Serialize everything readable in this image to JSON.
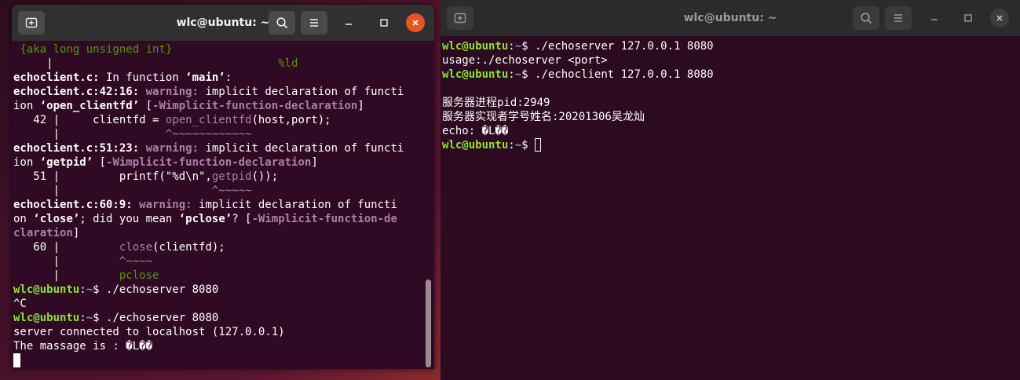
{
  "left_window": {
    "title": "wlc@ubuntu: ~",
    "lines": [
      [
        {
          "t": " {aka long unsigned int}",
          "c": "grn"
        }
      ],
      [
        {
          "t": "     |                                  "
        },
        {
          "t": "%ld",
          "c": "grn"
        }
      ],
      [
        {
          "t": "echoclient.c:",
          "c": "b"
        },
        {
          "t": " In function "
        },
        {
          "t": "‘main’",
          "c": "b"
        },
        {
          "t": ":"
        }
      ],
      [
        {
          "t": "echoclient.c:42:16:",
          "c": "b"
        },
        {
          "t": " "
        },
        {
          "t": "warning:",
          "c": "mb"
        },
        {
          "t": " implicit declaration of functi"
        }
      ],
      [
        {
          "t": "ion "
        },
        {
          "t": "‘open_clientfd’",
          "c": "b"
        },
        {
          "t": " ["
        },
        {
          "t": "-Wimplicit-function-declaration",
          "c": "mb"
        },
        {
          "t": "]"
        }
      ],
      [
        {
          "t": "   42 |     clientfd = "
        },
        {
          "t": "open_clientfd",
          "c": "m"
        },
        {
          "t": "(host,port);"
        }
      ],
      [
        {
          "t": "      |                "
        },
        {
          "t": "^~~~~~~~~~~~~",
          "c": "m"
        }
      ],
      [
        {
          "t": "echoclient.c:51:23:",
          "c": "b"
        },
        {
          "t": " "
        },
        {
          "t": "warning:",
          "c": "mb"
        },
        {
          "t": " implicit declaration of functi"
        }
      ],
      [
        {
          "t": "ion "
        },
        {
          "t": "‘getpid’",
          "c": "b"
        },
        {
          "t": " ["
        },
        {
          "t": "-Wimplicit-function-declaration",
          "c": "mb"
        },
        {
          "t": "]"
        }
      ],
      [
        {
          "t": "   51 |         printf(\"%d\\n\","
        },
        {
          "t": "getpid",
          "c": "m"
        },
        {
          "t": "());"
        }
      ],
      [
        {
          "t": "      |                       "
        },
        {
          "t": "^~~~~~",
          "c": "m"
        }
      ],
      [
        {
          "t": "echoclient.c:60:9:",
          "c": "b"
        },
        {
          "t": " "
        },
        {
          "t": "warning:",
          "c": "mb"
        },
        {
          "t": " implicit declaration of functi"
        }
      ],
      [
        {
          "t": "on "
        },
        {
          "t": "‘close’",
          "c": "b"
        },
        {
          "t": "; did you mean "
        },
        {
          "t": "‘pclose’",
          "c": "b"
        },
        {
          "t": "? ["
        },
        {
          "t": "-Wimplicit-function-de",
          "c": "mb"
        }
      ],
      [
        {
          "t": "claration",
          "c": "mb"
        },
        {
          "t": "]"
        }
      ],
      [
        {
          "t": "   60 |         "
        },
        {
          "t": "close",
          "c": "m"
        },
        {
          "t": "(clientfd);"
        }
      ],
      [
        {
          "t": "      |         "
        },
        {
          "t": "^~~~~",
          "c": "m"
        }
      ],
      [
        {
          "t": "      |         "
        },
        {
          "t": "pclose",
          "c": "grn"
        }
      ],
      [
        {
          "t": "wlc@ubuntu",
          "c": "g"
        },
        {
          "t": ":"
        },
        {
          "t": "~",
          "c": "blu"
        },
        {
          "t": "$ ./echoserver 8080"
        }
      ],
      [
        {
          "t": "^C"
        }
      ],
      [
        {
          "t": "wlc@ubuntu",
          "c": "g"
        },
        {
          "t": ":"
        },
        {
          "t": "~",
          "c": "blu"
        },
        {
          "t": "$ ./echoserver 8080"
        }
      ],
      [
        {
          "t": "server connected to localhost (127.0.0.1)"
        }
      ],
      [
        {
          "t": "The massage is : �L��"
        }
      ],
      [
        {
          "cursor": "block"
        }
      ]
    ]
  },
  "right_window": {
    "title": "wlc@ubuntu: ~",
    "lines": [
      [
        {
          "t": "wlc@ubuntu",
          "c": "g"
        },
        {
          "t": ":"
        },
        {
          "t": "~",
          "c": "blu"
        },
        {
          "t": "$ ./echoserver 127.0.0.1 8080"
        }
      ],
      [
        {
          "t": "usage:./echoserver <port>"
        }
      ],
      [
        {
          "t": "wlc@ubuntu",
          "c": "g"
        },
        {
          "t": ":"
        },
        {
          "t": "~",
          "c": "blu"
        },
        {
          "t": "$ ./echoclient 127.0.0.1 8080"
        }
      ],
      [
        {
          "t": ""
        }
      ],
      [
        {
          "t": "服务器进程pid:2949"
        }
      ],
      [
        {
          "t": "服务器实现者学号姓名:20201306吴龙灿"
        }
      ],
      [
        {
          "t": "echo: �L��"
        }
      ],
      [
        {
          "t": "wlc@ubuntu",
          "c": "g"
        },
        {
          "t": ":"
        },
        {
          "t": "~",
          "c": "blu"
        },
        {
          "t": "$ "
        },
        {
          "cursor": "hollow"
        }
      ]
    ]
  },
  "icons": {
    "new_tab": "new-tab-icon",
    "search": "search-icon",
    "menu": "hamburger-menu-icon",
    "minimize": "minimize-icon",
    "maximize": "maximize-icon",
    "close": "close-icon"
  },
  "colors": {
    "terminal_bg": "#300a24",
    "prompt_user": "#8ae234",
    "prompt_path": "#729fcf",
    "warning": "#ad7fa8",
    "note": "#4e9a06",
    "close_active": "#e95420"
  }
}
